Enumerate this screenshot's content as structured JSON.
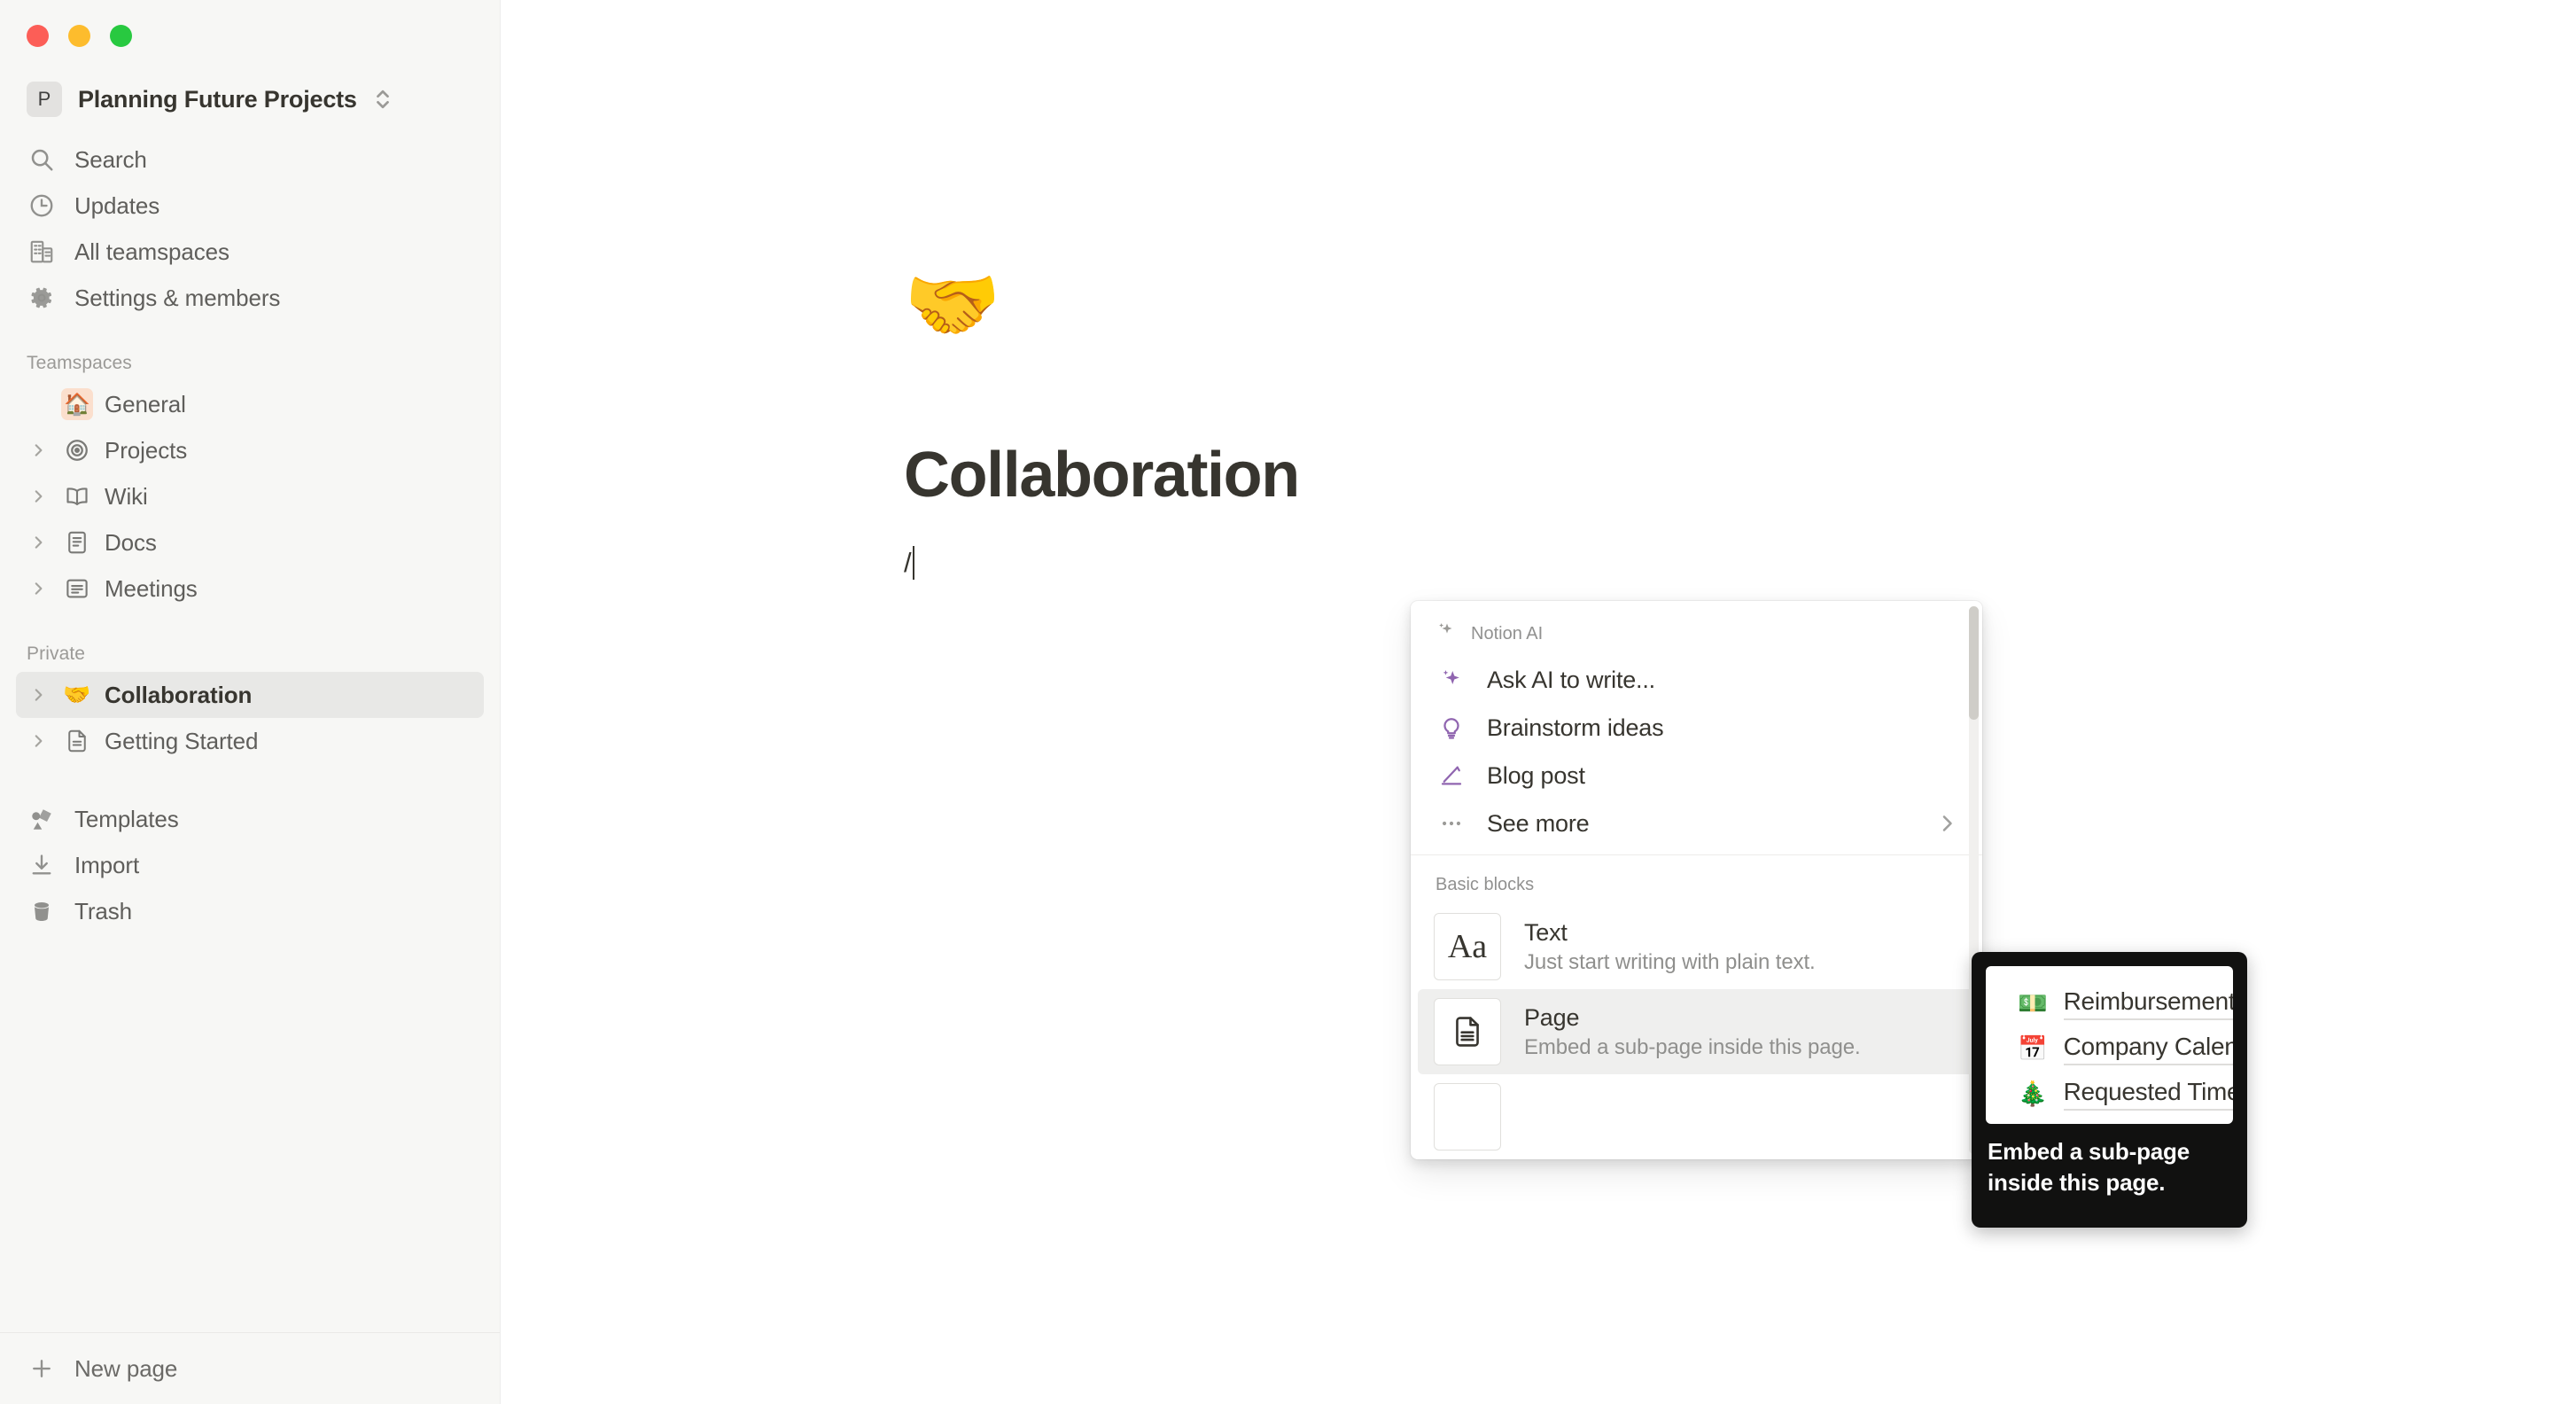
{
  "window": {
    "traffic_lights": [
      {
        "name": "close",
        "color": "#fc5e57"
      },
      {
        "name": "minimize",
        "color": "#fdbc2d"
      },
      {
        "name": "zoom",
        "color": "#28c940"
      }
    ]
  },
  "sidebar": {
    "workspace": {
      "badge": "P",
      "name": "Planning Future Projects"
    },
    "nav": [
      {
        "label": "Search",
        "icon": "search-icon"
      },
      {
        "label": "Updates",
        "icon": "clock-icon"
      },
      {
        "label": "All teamspaces",
        "icon": "building-icon"
      },
      {
        "label": "Settings & members",
        "icon": "gear-icon"
      }
    ],
    "teamspaces_header": "Teamspaces",
    "teamspaces": [
      {
        "label": "General",
        "icon": "house-emoji",
        "emoji": "🏠",
        "expandable": false,
        "selected": false
      },
      {
        "label": "Projects",
        "icon": "target-icon",
        "expandable": true,
        "selected": false
      },
      {
        "label": "Wiki",
        "icon": "book-icon",
        "expandable": true,
        "selected": false
      },
      {
        "label": "Docs",
        "icon": "doc-icon",
        "expandable": true,
        "selected": false
      },
      {
        "label": "Meetings",
        "icon": "list-doc-icon",
        "expandable": true,
        "selected": false
      }
    ],
    "private_header": "Private",
    "private": [
      {
        "label": "Collaboration",
        "icon": "handshake-emoji",
        "emoji": "🤝",
        "expandable": true,
        "selected": true
      },
      {
        "label": "Getting Started",
        "icon": "page-icon",
        "expandable": true,
        "selected": false
      }
    ],
    "lower_nav": [
      {
        "label": "Templates",
        "icon": "templates-icon"
      },
      {
        "label": "Import",
        "icon": "import-icon"
      },
      {
        "label": "Trash",
        "icon": "trash-icon"
      }
    ],
    "footer": {
      "label": "New page",
      "icon": "plus-icon"
    }
  },
  "page": {
    "emoji": "🤝",
    "title": "Collaboration",
    "typed_text": "/"
  },
  "slash_menu": {
    "ai_section": {
      "category": "Notion AI",
      "items": [
        {
          "label": "Ask AI to write...",
          "icon": "sparkle-icon",
          "has_chevron": false
        },
        {
          "label": "Brainstorm ideas",
          "icon": "lightbulb-icon",
          "has_chevron": false
        },
        {
          "label": "Blog post",
          "icon": "pen-icon",
          "has_chevron": false
        },
        {
          "label": "See more",
          "icon": "ellipsis-icon",
          "has_chevron": true
        }
      ]
    },
    "basic_section": {
      "category": "Basic blocks",
      "items": [
        {
          "name": "Text",
          "desc": "Just start writing with plain text.",
          "thumb": "Aa",
          "icon": "text-block-icon",
          "active": false
        },
        {
          "name": "Page",
          "desc": "Embed a sub-page inside this page.",
          "thumb": "",
          "icon": "page-block-icon",
          "active": true
        }
      ]
    }
  },
  "tooltip": {
    "preview_links": [
      {
        "emoji": "💵",
        "label": "Reimbursement"
      },
      {
        "emoji": "📅",
        "label": "Company Calendar"
      },
      {
        "emoji": "🎄",
        "label": "Requested Time Off"
      }
    ],
    "description": "Embed a sub-page inside this page."
  }
}
